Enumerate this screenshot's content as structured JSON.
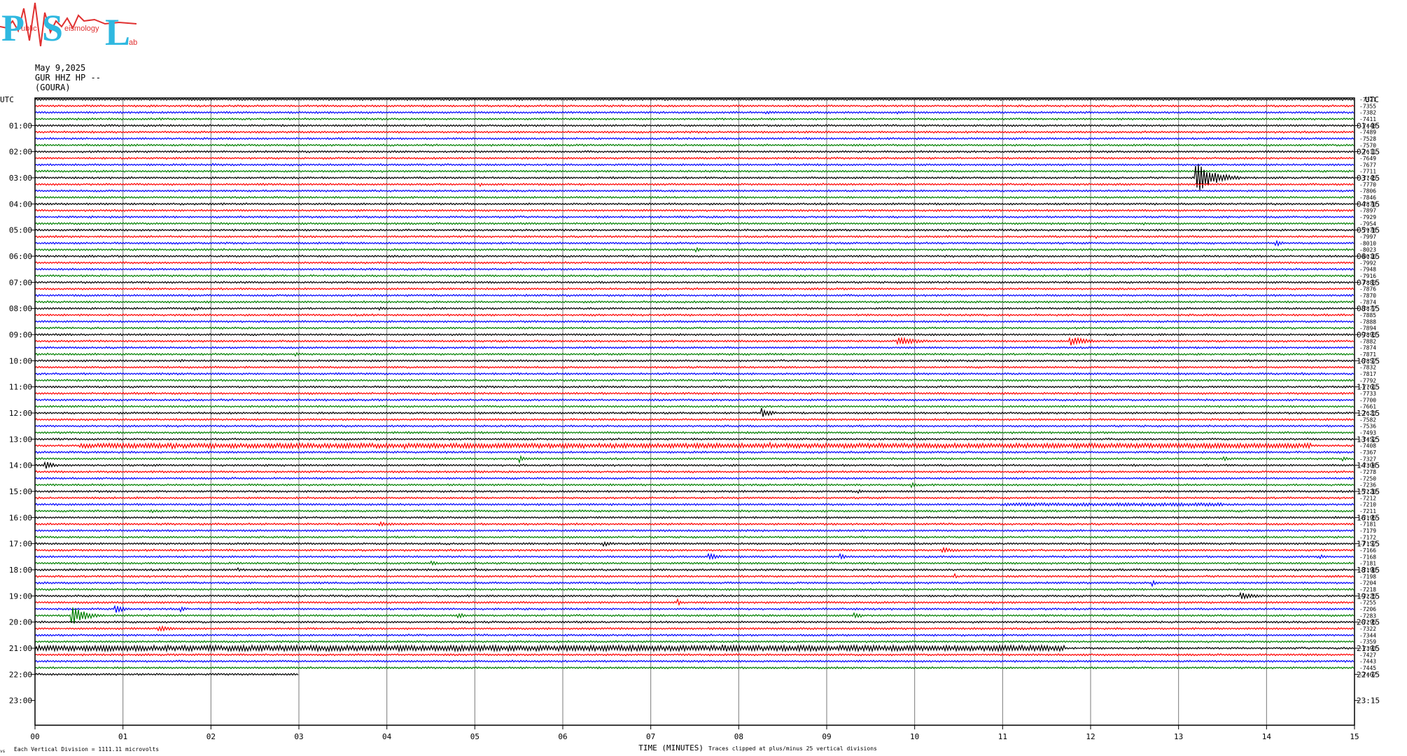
{
  "logo": {
    "letters": [
      "P",
      "S",
      "L"
    ],
    "small_words": [
      "ublic",
      "eismology",
      "ab"
    ],
    "colors": {
      "letters": "#2fb8e0",
      "words": "#e03030"
    }
  },
  "header": {
    "date": "May 9,2025",
    "channel": "GUR HHZ HP --",
    "station": "(GOURA)"
  },
  "chart_data": {
    "type": "line",
    "title": "",
    "xlabel": "TIME (MINUTES)",
    "ylabel": "",
    "xlim": [
      0,
      15
    ],
    "x_ticks": [
      "00",
      "01",
      "02",
      "03",
      "04",
      "05",
      "06",
      "07",
      "08",
      "09",
      "10",
      "11",
      "12",
      "13",
      "14",
      "15"
    ],
    "left_axis_title": "UTC",
    "right_axis_title": "UTC",
    "left_hour_labels": [
      "01:00",
      "02:00",
      "03:00",
      "04:00",
      "05:00",
      "06:00",
      "07:00",
      "08:00",
      "09:00",
      "10:00",
      "11:00",
      "12:00",
      "13:00",
      "14:00",
      "15:00",
      "16:00",
      "17:00",
      "18:00",
      "19:00",
      "20:00",
      "21:00",
      "22:00",
      "23:00"
    ],
    "right_hour_labels": [
      "01:15",
      "02:15",
      "03:15",
      "04:15",
      "05:15",
      "06:15",
      "07:15",
      "08:15",
      "09:15",
      "10:15",
      "11:15",
      "12:15",
      "13:15",
      "14:15",
      "15:15",
      "16:15",
      "17:15",
      "18:15",
      "19:15",
      "20:15",
      "21:15",
      "22:15",
      "23:15"
    ],
    "rows_per_hour": 4,
    "rows_recorded": 89,
    "last_row_fraction": 0.2,
    "trace_colors": [
      "#000000",
      "#ff0000",
      "#0000ff",
      "#008000"
    ],
    "row_offsets": [
      "-7321",
      "-7355",
      "-7382",
      "-7411",
      "-7448",
      "-7489",
      "-7528",
      "-7570",
      "-7611",
      "-7649",
      "-7677",
      "-7711",
      "-7745",
      "-7770",
      "-7806",
      "-7846",
      "-7870",
      "-7897",
      "-7929",
      "-7954",
      "-7978",
      "-7997",
      "-8010",
      "-8023",
      "-8016",
      "-7992",
      "-7948",
      "-7916",
      "-7883",
      "-7876",
      "-7870",
      "-7874",
      "-7877",
      "-7885",
      "-7888",
      "-7894",
      "-7893",
      "-7882",
      "-7874",
      "-7871",
      "-7857",
      "-7832",
      "-7817",
      "-7792",
      "-7761",
      "-7733",
      "-7700",
      "-7661",
      "-7623",
      "-7582",
      "-7536",
      "-7493",
      "-7452",
      "-7408",
      "-7367",
      "-7327",
      "-7304",
      "-7278",
      "-7250",
      "-7236",
      "-7220",
      "-7212",
      "-7210",
      "-7211",
      "-7195",
      "-7181",
      "-7179",
      "-7172",
      "-7157",
      "-7166",
      "-7168",
      "-7181",
      "-7190",
      "-7198",
      "-7204",
      "-7218",
      "-7225",
      "-7255",
      "-7206",
      "-7283",
      "-7295",
      "-7322",
      "-7344",
      "-7359",
      "-7393",
      "-7427",
      "-7443",
      "-7445",
      "-7467",
      "-7496"
    ],
    "events": [
      {
        "row": 0,
        "minute": 10.1,
        "amp": 0.8,
        "dur": 0.5
      },
      {
        "row": 2,
        "minute": 8.3,
        "amp": 1.2,
        "dur": 0.5
      },
      {
        "row": 2,
        "minute": 9.8,
        "amp": 1.0,
        "dur": 0.3
      },
      {
        "row": 4,
        "minute": 8.15,
        "amp": 1.8,
        "dur": 0.1
      },
      {
        "row": 10,
        "minute": 2.0,
        "amp": 1.0,
        "dur": 0.4
      },
      {
        "row": 12,
        "minute": 13.18,
        "amp": 12.0,
        "dur": 0.6
      },
      {
        "row": 13,
        "minute": 5.05,
        "amp": 2.0,
        "dur": 0.15
      },
      {
        "row": 19,
        "minute": 12.6,
        "amp": 1.0,
        "dur": 0.1
      },
      {
        "row": 21,
        "minute": 12.05,
        "amp": 2.0,
        "dur": 0.1
      },
      {
        "row": 22,
        "minute": 14.1,
        "amp": 2.5,
        "dur": 0.2
      },
      {
        "row": 23,
        "minute": 7.5,
        "amp": 2.0,
        "dur": 0.2
      },
      {
        "row": 28,
        "minute": 1.3,
        "amp": 1.0,
        "dur": 0.1
      },
      {
        "row": 32,
        "minute": 1.8,
        "amp": 1.5,
        "dur": 0.3
      },
      {
        "row": 32,
        "minute": 3.9,
        "amp": 1.2,
        "dur": 0.4
      },
      {
        "row": 37,
        "minute": 9.8,
        "amp": 2.5,
        "dur": 0.8
      },
      {
        "row": 37,
        "minute": 11.75,
        "amp": 3.5,
        "dur": 0.6
      },
      {
        "row": 38,
        "minute": 6.75,
        "amp": 1.5,
        "dur": 0.1
      },
      {
        "row": 39,
        "minute": 2.95,
        "amp": 1.5,
        "dur": 0.2
      },
      {
        "row": 40,
        "minute": 1.65,
        "amp": 1.2,
        "dur": 0.2
      },
      {
        "row": 42,
        "minute": 14.4,
        "amp": 1.0,
        "dur": 0.6
      },
      {
        "row": 48,
        "minute": 8.25,
        "amp": 4.0,
        "dur": 0.3
      },
      {
        "row": 53,
        "minute": 0.5,
        "amp": 1.5,
        "dur": 14.0
      },
      {
        "row": 53,
        "minute": 4.2,
        "amp": 3.0,
        "dur": 0.1
      },
      {
        "row": 53,
        "minute": 1.55,
        "amp": 2.5,
        "dur": 0.1
      },
      {
        "row": 53,
        "minute": 8.35,
        "amp": 2.5,
        "dur": 0.1
      },
      {
        "row": 53,
        "minute": 10.25,
        "amp": 2.5,
        "dur": 0.2
      },
      {
        "row": 55,
        "minute": 5.5,
        "amp": 3.0,
        "dur": 0.2
      },
      {
        "row": 55,
        "minute": 13.5,
        "amp": 2.0,
        "dur": 0.2
      },
      {
        "row": 55,
        "minute": 14.85,
        "amp": 2.0,
        "dur": 0.2
      },
      {
        "row": 56,
        "minute": 0.1,
        "amp": 3.0,
        "dur": 0.4
      },
      {
        "row": 59,
        "minute": 9.95,
        "amp": 2.0,
        "dur": 0.3
      },
      {
        "row": 60,
        "minute": 9.35,
        "amp": 1.5,
        "dur": 0.2
      },
      {
        "row": 62,
        "minute": 11.0,
        "amp": 1.0,
        "dur": 2.5
      },
      {
        "row": 63,
        "minute": 1.3,
        "amp": 1.2,
        "dur": 0.6
      },
      {
        "row": 65,
        "minute": 3.9,
        "amp": 1.5,
        "dur": 0.6
      },
      {
        "row": 68,
        "minute": 6.45,
        "amp": 2.0,
        "dur": 0.3
      },
      {
        "row": 69,
        "minute": 10.3,
        "amp": 2.0,
        "dur": 0.6
      },
      {
        "row": 70,
        "minute": 7.65,
        "amp": 2.5,
        "dur": 0.4
      },
      {
        "row": 70,
        "minute": 9.15,
        "amp": 2.0,
        "dur": 0.2
      },
      {
        "row": 70,
        "minute": 14.6,
        "amp": 2.0,
        "dur": 0.2
      },
      {
        "row": 71,
        "minute": 4.5,
        "amp": 2.0,
        "dur": 0.2
      },
      {
        "row": 72,
        "minute": 2.3,
        "amp": 2.0,
        "dur": 0.1
      },
      {
        "row": 72,
        "minute": 5.0,
        "amp": 1.5,
        "dur": 0.1
      },
      {
        "row": 73,
        "minute": 10.45,
        "amp": 2.0,
        "dur": 0.1
      },
      {
        "row": 74,
        "minute": 12.7,
        "amp": 3.0,
        "dur": 0.1
      },
      {
        "row": 76,
        "minute": 13.7,
        "amp": 2.5,
        "dur": 0.6
      },
      {
        "row": 77,
        "minute": 7.3,
        "amp": 4.0,
        "dur": 0.1
      },
      {
        "row": 78,
        "minute": 0.9,
        "amp": 3.5,
        "dur": 0.3
      },
      {
        "row": 78,
        "minute": 1.65,
        "amp": 2.0,
        "dur": 0.2
      },
      {
        "row": 79,
        "minute": 0.4,
        "amp": 7.0,
        "dur": 0.5
      },
      {
        "row": 79,
        "minute": 4.8,
        "amp": 2.0,
        "dur": 0.3
      },
      {
        "row": 79,
        "minute": 9.3,
        "amp": 2.5,
        "dur": 0.3
      },
      {
        "row": 81,
        "minute": 1.4,
        "amp": 2.0,
        "dur": 0.5
      },
      {
        "row": 84,
        "minute": 0.0,
        "amp": 1.8,
        "dur": 11.7
      },
      {
        "row": 84,
        "minute": 7.8,
        "amp": 2.5,
        "dur": 1.0
      }
    ],
    "footer_left": "Each Vertical Division = 1111.11 microvolts",
    "footer_right": "Traces clipped at plus/minus 25 vertical divisions",
    "corner_mark": "vs"
  }
}
